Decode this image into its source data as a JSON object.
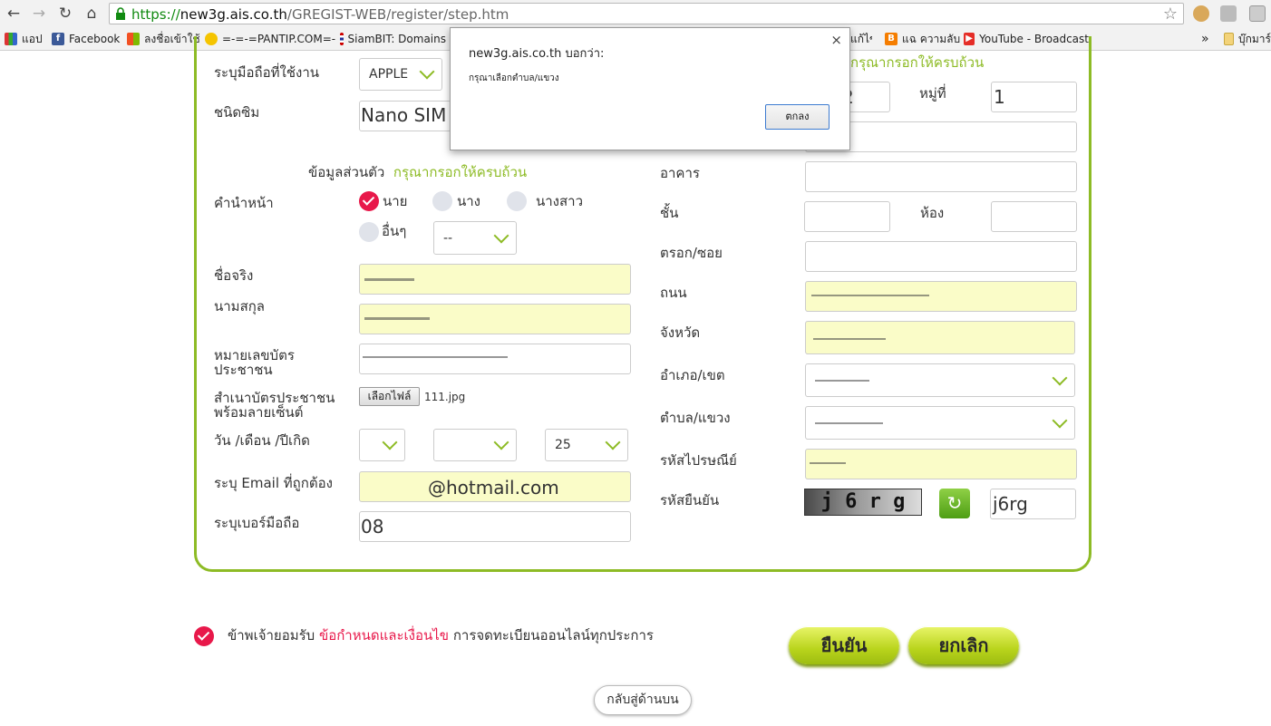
{
  "browser": {
    "url_scheme": "https://",
    "url_host": "new3g.ais.co.th",
    "url_path": "/GREGIST-WEB/register/step.htm",
    "bookmarks": [
      "แอป",
      "Facebook",
      "ลงชื่อเข้าใช้",
      "=-=-=PANTIP.COM=-",
      "SiamBIT: Domains",
      "แฉ ความลับ",
      "YouTube - Broadcast",
      "บุ๊กมาร์"
    ],
    "bookmark_partial": "แก้ไข",
    "more": "»"
  },
  "dialog": {
    "title": "new3g.ais.co.th บอกว่า:",
    "message": "กรุณาเลือกตำบล/แขวง",
    "ok": "ตกลง",
    "close": "×"
  },
  "left": {
    "device_label": "ระบุมือถือที่ใช้งาน",
    "device_value": "APPLE",
    "sim_label": "ชนิดซิม",
    "sim_value": "Nano SIM",
    "section_title": "ข้อมูลส่วนตัว",
    "section_hint": "กรุณากรอกให้ครบถ้วน",
    "title_label": "คำนำหน้า",
    "title_options": [
      "นาย",
      "นาง",
      "นางสาว",
      "อื่นๆ"
    ],
    "title_other_value": "--",
    "firstname_label": "ชื่อจริง",
    "lastname_label": "นามสกุล",
    "idcard_label_1": "หมายเลขบัตร",
    "idcard_label_2": "ประชาชน",
    "idcopy_label_1": "สำเนาบัตรประชาชน",
    "idcopy_label_2": "พร้อมลายเซ็นต์",
    "file_button": "เลือกไฟล์",
    "file_name": "111.jpg",
    "birth_label": "วัน /เดือน /ปีเกิด",
    "birth_year": "25",
    "email_label": "ระบุ Email ที่ถูกต้อง",
    "email_value": "@hotmail.com",
    "mobile_label": "ระบุเบอร์มือถือ",
    "mobile_value": "08"
  },
  "right": {
    "hint": "กรุณากรอกให้ครบถ้วน",
    "house_no_partial": "2",
    "moo_label": "หมู่ที่",
    "moo_value": "1",
    "building_label": "อาคาร",
    "floor_label": "ชั้น",
    "room_label": "ห้อง",
    "soi_label": "ตรอก/ซอย",
    "road_label": "ถนน",
    "province_label": "จังหวัด",
    "district_label": "อำเภอ/เขต",
    "subdistrict_label": "ตำบล/แขวง",
    "postcode_label": "รหัสไปรษณีย์",
    "captcha_label": "รหัสยืนยัน",
    "captcha_image_text": "j 6 r g",
    "captcha_value": "j6rg"
  },
  "footer": {
    "agree_prefix": "ข้าพเจ้ายอมรับ",
    "agree_link": "ข้อกำหนดและเงื่อนไข",
    "agree_suffix": "การจดทะเบียนออนไลน์ทุกประการ",
    "confirm": "ยืนยัน",
    "cancel": "ยกเลิก",
    "back": "กลับสู่ด้านบน"
  },
  "colors": {
    "accent": "#8dbb25",
    "check": "#e8184a",
    "input_yellow": "#fafcc8",
    "link": "#e8184a"
  }
}
